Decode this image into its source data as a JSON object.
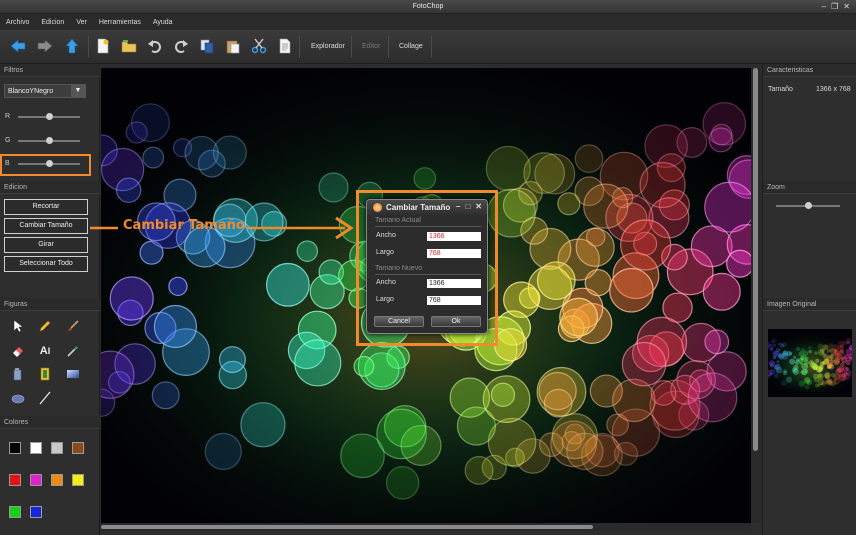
{
  "app": {
    "title": "FotoChop"
  },
  "menu": [
    "Archivo",
    "Edicion",
    "Ver",
    "Herramientas",
    "Ayuda"
  ],
  "toolbar": {
    "explorador": "Explorador",
    "editor": "Editor",
    "collage": "Collage"
  },
  "filtros": {
    "heading": "Filtros",
    "selected": "BlancoYNegro",
    "sliders": [
      {
        "label": "R",
        "value": 0.5
      },
      {
        "label": "G",
        "value": 0.5
      },
      {
        "label": "B",
        "value": 0.5
      }
    ]
  },
  "edicion": {
    "heading": "Edicion",
    "buttons": [
      "Recortar",
      "Cambiar Tamaño",
      "Girar",
      "Seleccionar Todo"
    ]
  },
  "figuras": {
    "heading": "Figuras"
  },
  "colores": {
    "heading": "Colores",
    "swatches": [
      "#000000",
      "#ffffff",
      "#c8c8c8",
      "#8a4a1a",
      "#e41414",
      "#e020c8",
      "#f08a14",
      "#f0f014",
      "#14d214",
      "#1428e0"
    ]
  },
  "callout": {
    "label": "Cambiar Tamaño",
    "color": "#f08a2c"
  },
  "dialog": {
    "title": "Cambiar Tamaño",
    "actual_heading": "Tamano Actual",
    "nuevo_heading": "Tamano Nuevo",
    "actual_ancho_label": "Ancho",
    "actual_largo_label": "Largo",
    "actual_ancho": "1366",
    "actual_largo": "768",
    "nuevo_ancho_label": "Ancho",
    "nuevo_largo_label": "Largo",
    "nuevo_ancho": "1366",
    "nuevo_largo": "768",
    "cancel": "Cancel",
    "ok": "Ok"
  },
  "caracteristicas": {
    "heading": "Caracteristicas",
    "label": "Tamaño",
    "value": "1366 x 768"
  },
  "zoom": {
    "heading": "Zoom",
    "value": 0.5
  },
  "imagen_original": {
    "heading": "Imagen Original"
  }
}
